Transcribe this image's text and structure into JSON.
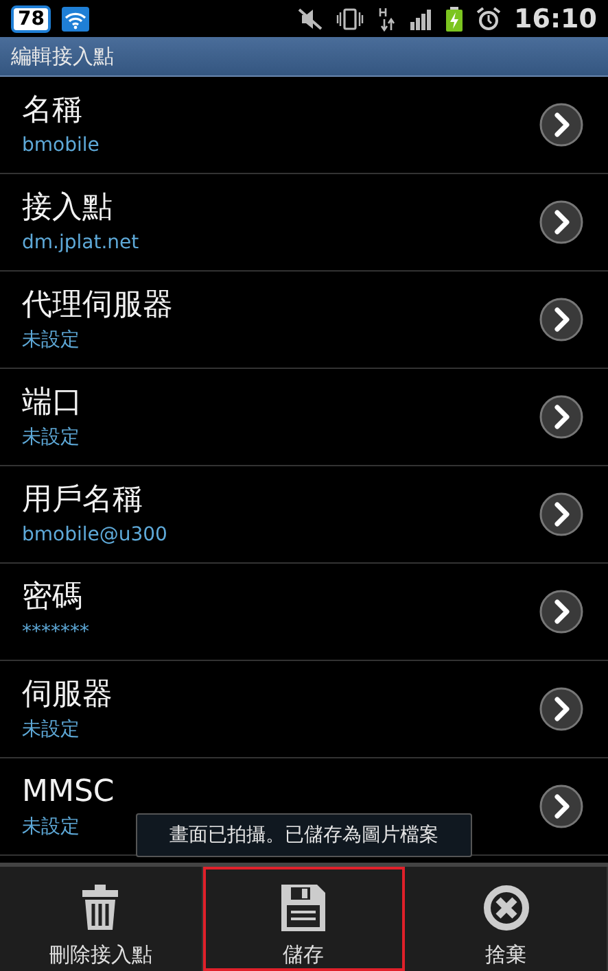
{
  "status_bar": {
    "badge": "78",
    "time": "16:10"
  },
  "title_bar": {
    "title": "編輯接入點"
  },
  "settings": [
    {
      "label": "名稱",
      "value": "bmobile"
    },
    {
      "label": "接入點",
      "value": "dm.jplat.net"
    },
    {
      "label": "代理伺服器",
      "value": "未設定"
    },
    {
      "label": "端口",
      "value": "未設定"
    },
    {
      "label": "用戶名稱",
      "value": "bmobile@u300"
    },
    {
      "label": "密碼",
      "value": "*******"
    },
    {
      "label": "伺服器",
      "value": "未設定"
    },
    {
      "label": "MMSC",
      "value": "未設定"
    }
  ],
  "toast": {
    "text": "畫面已拍攝。已儲存為圖片檔案"
  },
  "menu": [
    {
      "label": "刪除接入點",
      "kind": "delete",
      "highlighted": false
    },
    {
      "label": "儲存",
      "kind": "save",
      "highlighted": true
    },
    {
      "label": "捨棄",
      "kind": "discard",
      "highlighted": false
    }
  ]
}
